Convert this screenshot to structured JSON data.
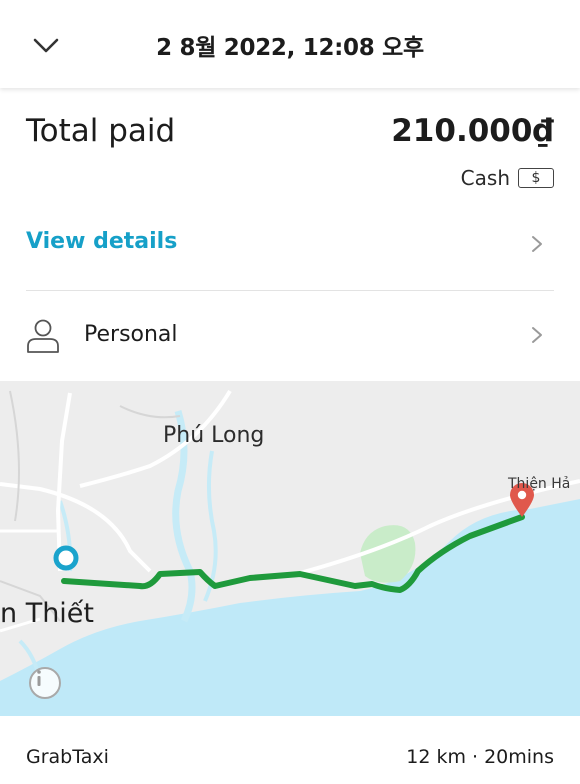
{
  "header": {
    "title": "2 8월 2022, 12:08 오후",
    "back_icon": "chevron-down-icon"
  },
  "payment": {
    "total_label": "Total paid",
    "total_amount": "210.000₫",
    "method_label": "Cash",
    "method_icon_text": "$"
  },
  "details": {
    "label": "View details",
    "accent_color": "#16a0c8"
  },
  "profile": {
    "label": "Personal",
    "icon": "person-icon"
  },
  "map": {
    "labels": {
      "place_1": "Phú Long",
      "place_2": "n Thiết",
      "place_3": "Thiện Hả"
    },
    "route_color": "#1f9a3c",
    "sea_color": "#bfe9f8",
    "pickup_color": "#1aa3cc",
    "dropoff_color": "#e0584c"
  },
  "trip": {
    "service": "GrabTaxi",
    "summary": "12 km · 20mins"
  }
}
